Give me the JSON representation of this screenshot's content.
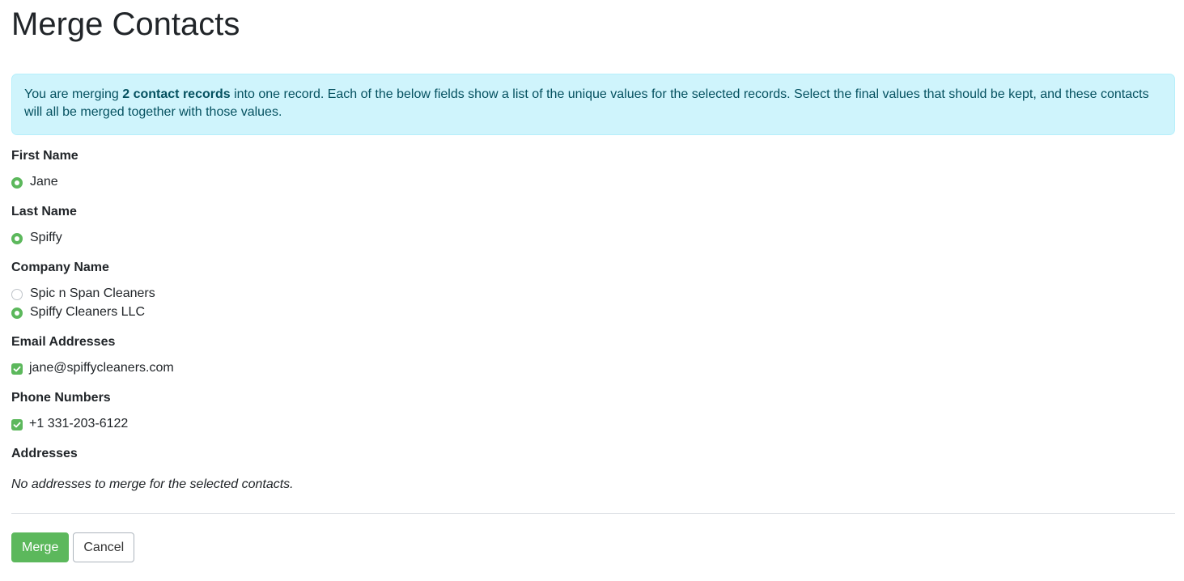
{
  "page": {
    "title": "Merge Contacts"
  },
  "alert": {
    "prefix": "You are merging ",
    "bold": "2 contact records",
    "suffix": " into one record.  Each of the below fields show a list of the unique values for the selected records.  Select the final values that should be kept, and these contacts will all be merged together with those values."
  },
  "fields": {
    "first_name": {
      "label": "First Name",
      "options": [
        {
          "value": "Jane",
          "checked": true
        }
      ]
    },
    "last_name": {
      "label": "Last Name",
      "options": [
        {
          "value": "Spiffy",
          "checked": true
        }
      ]
    },
    "company_name": {
      "label": "Company Name",
      "options": [
        {
          "value": "Spic n Span Cleaners",
          "checked": false
        },
        {
          "value": "Spiffy Cleaners LLC",
          "checked": true
        }
      ]
    },
    "emails": {
      "label": "Email Addresses",
      "options": [
        {
          "value": "jane@spiffycleaners.com",
          "checked": true
        }
      ]
    },
    "phones": {
      "label": "Phone Numbers",
      "options": [
        {
          "value": "+1 331-203-6122",
          "checked": true
        }
      ]
    },
    "addresses": {
      "label": "Addresses",
      "empty_message": "No addresses to merge for the selected contacts."
    }
  },
  "actions": {
    "merge_label": "Merge",
    "cancel_label": "Cancel"
  },
  "colors": {
    "accent_green": "#5cb85c",
    "alert_bg": "#cff4fc",
    "alert_text": "#055160"
  },
  "icons": {
    "checkbox_checked": "check-icon"
  }
}
